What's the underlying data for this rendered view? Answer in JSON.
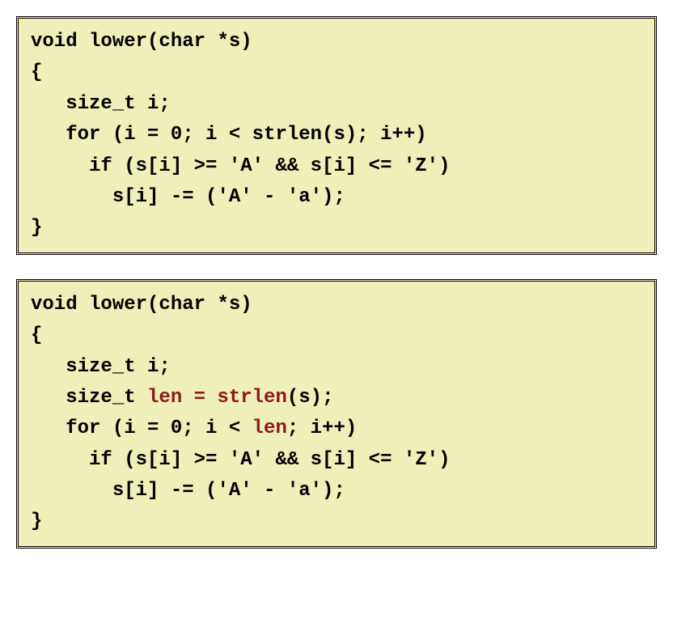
{
  "box1": {
    "line1": "void lower(char *s)",
    "line2": "{",
    "line3": "   size_t i;",
    "line4": "   for (i = 0; i < strlen(s); i++)",
    "line5": "     if (s[i] >= 'A' && s[i] <= 'Z')",
    "line6": "       s[i] -= ('A' - 'a');",
    "line7": "}"
  },
  "box2": {
    "line1": "void lower(char *s)",
    "line2": "{",
    "line3": "   size_t i;",
    "line4a": "   size_t ",
    "line4b_hl": "len = strlen",
    "line4c": "(s);",
    "line5a": "   for (i = 0; i < ",
    "line5b_hl": "len",
    "line5c": "; i++)",
    "line6": "     if (s[i] >= 'A' && s[i] <= 'Z')",
    "line7": "       s[i] -= ('A' - 'a');",
    "line8": "}"
  }
}
